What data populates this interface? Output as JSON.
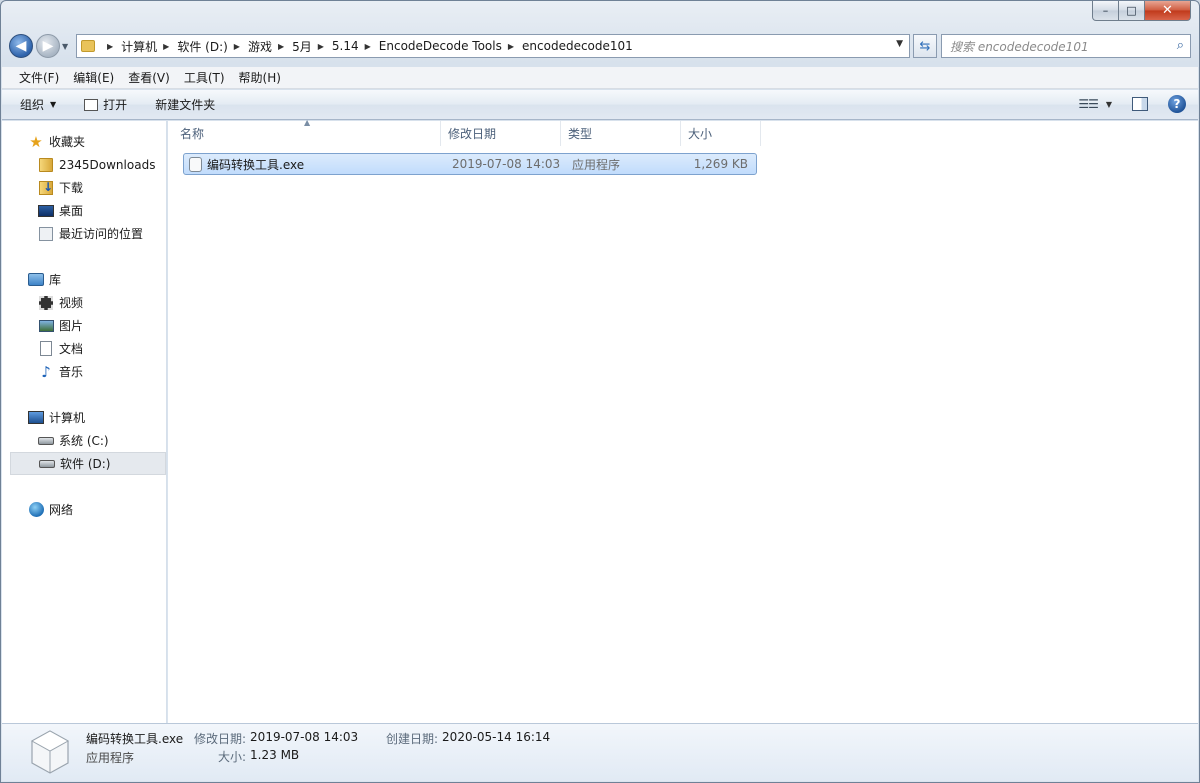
{
  "window": {
    "caption": {
      "minimize": "–",
      "maximize": "□",
      "close": "✕"
    }
  },
  "navigation": {
    "back_glyph": "◀",
    "forward_glyph": "▶",
    "breadcrumbs": [
      "计算机",
      "软件 (D:)",
      "游戏",
      "5月",
      "5.14",
      "EncodeDecode Tools",
      "encodedecode101"
    ],
    "search_placeholder": "搜索 encodedecode101"
  },
  "menubar": [
    "文件(F)",
    "编辑(E)",
    "查看(V)",
    "工具(T)",
    "帮助(H)"
  ],
  "commandbar": {
    "organize": "组织",
    "open": "打开",
    "new_folder": "新建文件夹"
  },
  "sidebar": {
    "favorites": {
      "label": "收藏夹",
      "items": [
        "2345Downloads",
        "下载",
        "桌面",
        "最近访问的位置"
      ]
    },
    "libraries": {
      "label": "库",
      "items": [
        "视频",
        "图片",
        "文档",
        "音乐"
      ]
    },
    "computer": {
      "label": "计算机",
      "items": [
        "系统 (C:)",
        "软件 (D:)"
      ]
    },
    "network": {
      "label": "网络"
    }
  },
  "filelist": {
    "columns": [
      "名称",
      "修改日期",
      "类型",
      "大小"
    ],
    "rows": [
      {
        "name": "编码转换工具.exe",
        "modified": "2019-07-08 14:03",
        "type": "应用程序",
        "size": "1,269 KB"
      }
    ]
  },
  "details": {
    "name": "编码转换工具.exe",
    "type": "应用程序",
    "modified_label": "修改日期:",
    "modified": "2019-07-08 14:03",
    "created_label": "创建日期:",
    "created": "2020-05-14 16:14",
    "size_label": "大小:",
    "size": "1.23 MB"
  },
  "colors": {
    "selection": "#cce1fb",
    "selection_border": "#7da2ce",
    "header_text": "#4c607a"
  }
}
